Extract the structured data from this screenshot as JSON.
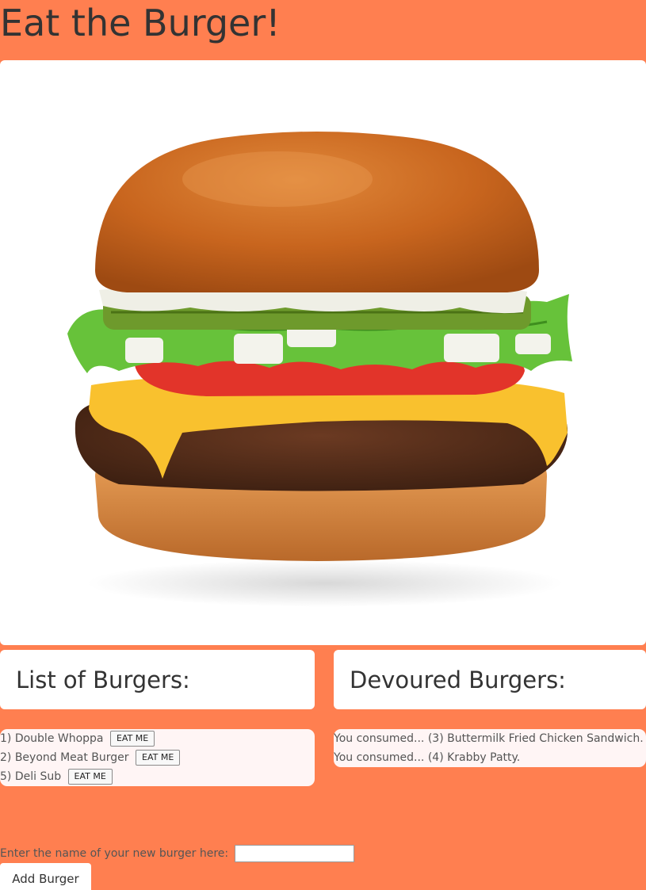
{
  "page": {
    "title": "Eat the Burger!",
    "background_color": "#FF7F50"
  },
  "hero": {
    "image_icon": "burger-image"
  },
  "burgers_section": {
    "heading": "List of Burgers:",
    "items": [
      {
        "label": "1) Double Whoppa",
        "button": "EAT ME"
      },
      {
        "label": "2) Beyond Meat Burger",
        "button": "EAT ME"
      },
      {
        "label": "5) Deli Sub",
        "button": "EAT ME"
      }
    ]
  },
  "devoured_section": {
    "heading": "Devoured Burgers:",
    "items": [
      "You consumed... (3) Buttermilk Fried Chicken Sandwich.",
      "You consumed... (4) Krabby Patty."
    ]
  },
  "form": {
    "label": "Enter the name of your new burger here:",
    "input_value": "",
    "submit_label": "Add Burger"
  }
}
